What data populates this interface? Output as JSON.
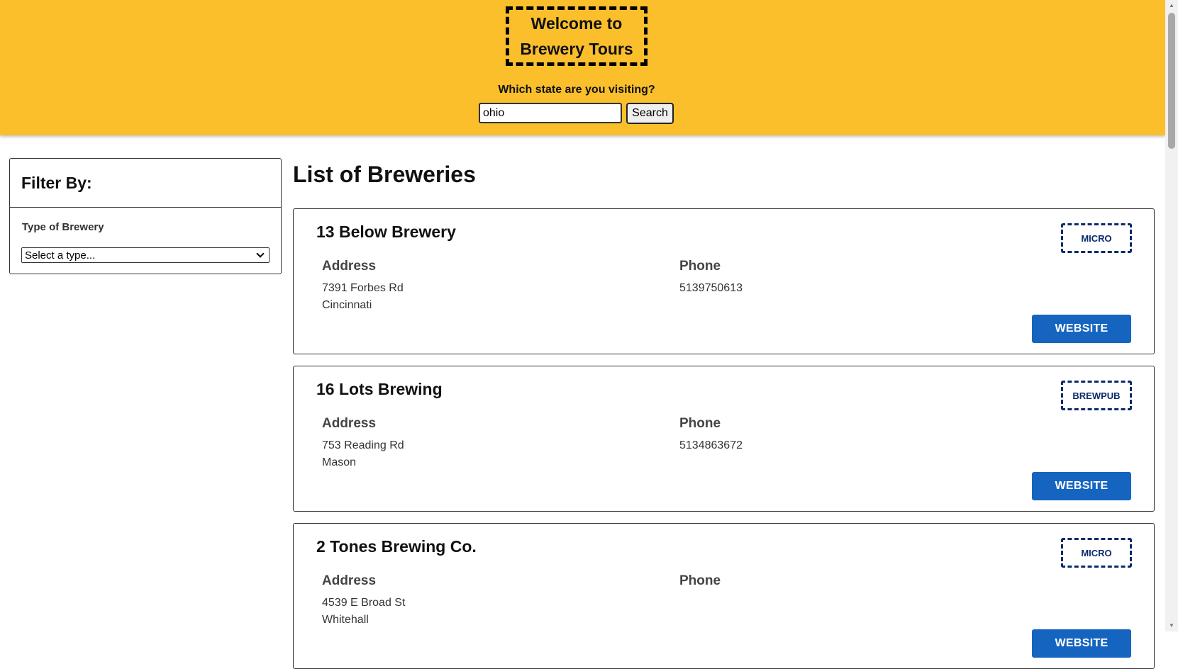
{
  "header": {
    "logo_line1": "Welcome to",
    "logo_line2": "Brewery Tours",
    "search_label": "Which state are you visiting?",
    "search_value": "ohio",
    "search_button": "Search",
    "background_color": "#fbbf2c"
  },
  "filter": {
    "title": "Filter By:",
    "type_label": "Type of Brewery",
    "select_value": "Select a type..."
  },
  "list": {
    "title": "List of Breweries",
    "address_label": "Address",
    "phone_label": "Phone",
    "website_label": "WEBSITE",
    "accent_color": "#1565c0",
    "badge_color": "#0b2a6b",
    "breweries": [
      {
        "name": "13 Below Brewery",
        "type": "MICRO",
        "street": "7391 Forbes Rd",
        "city": "Cincinnati",
        "phone": "5139750613"
      },
      {
        "name": "16 Lots Brewing",
        "type": "BREWPUB",
        "street": "753 Reading Rd",
        "city": "Mason",
        "phone": "5134863672"
      },
      {
        "name": "2 Tones Brewing Co.",
        "type": "MICRO",
        "street": "4539 E Broad St",
        "city": "Whitehall",
        "phone": ""
      }
    ]
  }
}
